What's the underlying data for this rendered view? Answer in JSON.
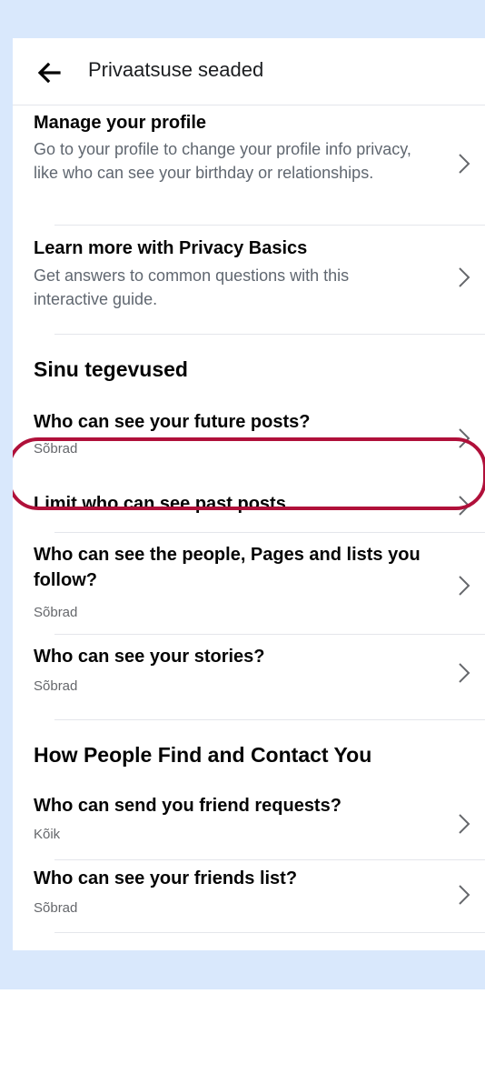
{
  "header": {
    "title": "Privaatsuse seaded",
    "back_icon": "arrow-left-icon"
  },
  "settings_top": [
    {
      "title": "Manage your profile",
      "description": "Go to your profile to change your profile info privacy, like who can see your birthday or relationships."
    },
    {
      "title": "Learn more with Privacy Basics",
      "description": "Get answers to common questions with this interactive guide."
    }
  ],
  "sections": [
    {
      "title": "Sinu tegevused",
      "items": [
        {
          "title": "Who can see your future posts?",
          "value": "Sõbrad"
        },
        {
          "title": "Limit who can see past posts",
          "value": ""
        },
        {
          "title": "Who can see the people, Pages and lists you follow?",
          "value": "Sõbrad"
        },
        {
          "title": "Who can see your stories?",
          "value": "Sõbrad"
        }
      ]
    },
    {
      "title": "How People Find and Contact You",
      "items": [
        {
          "title": "Who can send you friend requests?",
          "value": "Kõik"
        },
        {
          "title": "Who can see your friends list?",
          "value": "Sõbrad"
        }
      ]
    }
  ],
  "colors": {
    "background_frame": "#d9e8fc",
    "highlight": "#b0103a",
    "divider": "#e4e6eb",
    "secondary_text": "#65676b"
  }
}
